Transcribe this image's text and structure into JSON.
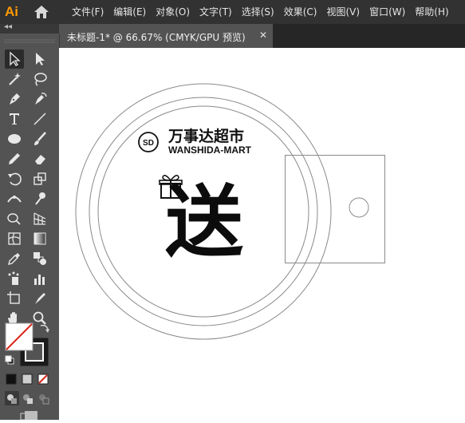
{
  "app": {
    "logo_text": "Ai",
    "brand_color": "#ff9a00"
  },
  "menu": {
    "items": [
      "文件(F)",
      "编辑(E)",
      "对象(O)",
      "文字(T)",
      "选择(S)",
      "效果(C)",
      "视图(V)",
      "窗口(W)",
      "帮助(H)"
    ]
  },
  "panel": {
    "collapse_glyph": "◂◂"
  },
  "document": {
    "tab_title": "未标题-1* @ 66.67% (CMYK/GPU 预览)",
    "close_glyph": "✕"
  },
  "tools": [
    "selection-tool",
    "direct-selection-tool",
    "magic-wand-tool",
    "lasso-tool",
    "pen-tool",
    "curvature-tool",
    "type-tool",
    "line-segment-tool",
    "ellipse-tool",
    "paintbrush-tool",
    "pencil-tool",
    "eraser-tool",
    "rotate-tool",
    "scale-tool",
    "width-tool",
    "puppet-warp-tool",
    "shape-builder-tool",
    "perspective-grid-tool",
    "mesh-tool",
    "gradient-tool",
    "eyedropper-tool",
    "blend-tool",
    "symbol-sprayer-tool",
    "column-graph-tool",
    "artboard-tool",
    "slice-tool",
    "hand-tool",
    "zoom-tool"
  ],
  "artwork": {
    "logo_badge": "SD",
    "brand_name": "万事达超市",
    "brand_name_en": "WANSHIDA-MART",
    "main_glyph": "送"
  },
  "colors": {
    "menubar": "#323232",
    "tool_panel": "#535353",
    "stroke": "#8a8a8a",
    "swap_red": "#d9281e"
  }
}
